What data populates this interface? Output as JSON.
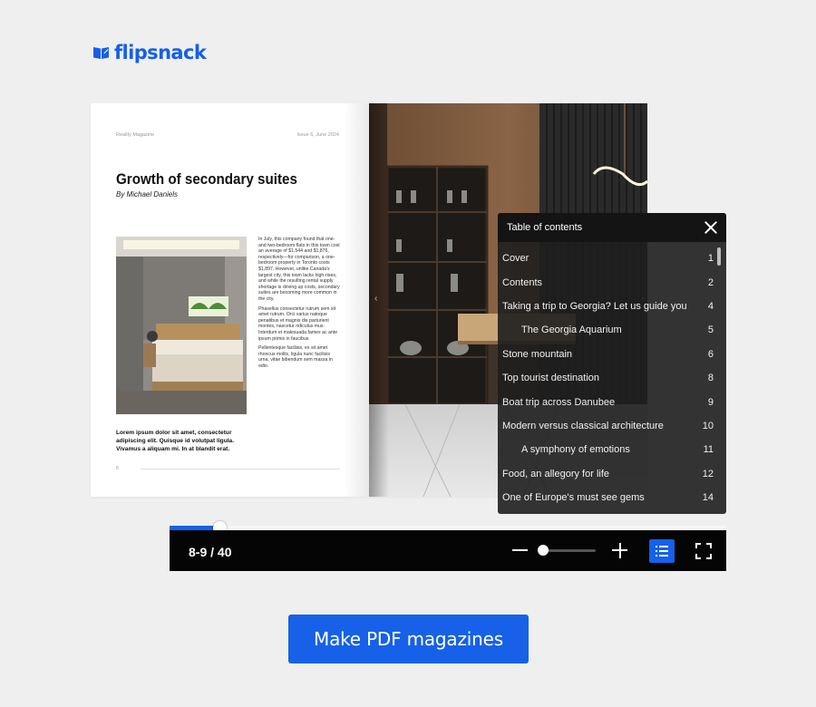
{
  "brand": {
    "name": "flipsnack",
    "color": "#1560e6"
  },
  "magazine": {
    "header_left": "Reality Magazine",
    "header_right": "Issue 6, June 2024",
    "title": "Growth of secondary suites",
    "byline": "By Michael Daniels",
    "body": [
      "In July, this company found that one- and two-bedroom flats in this town cost an average of $1,544 and $1,876, respectively—for comparison, a one-bedroom property in Toronto costs $1,897. However, unlike Canada's largest city, this town lacks high-rises, and while the resulting rental supply shortage is driving up costs, secondary suites are becoming more common in the city.",
      "Phasellus consectetur rutrum sem sit amet rutrum. Orci varius natoque penatibus et magnis dis parturient montes, nascetur ridiculus mus. Interdum et malesuada fames ac ante ipsum primis in faucibus.",
      "Pellentesque facilisis, ex sit amet rhoncus mollis, ligula nunc facilisis urna, vitae bibendum sem massa in odio."
    ],
    "lede": "Lorem ipsum dolor sit amet, consectetur adipiscing elit. Quisque id volutpat ligula. Vivamus a aliquam mi. In at blandit erat.",
    "folio": "8"
  },
  "toc": {
    "title": "Table of contents",
    "items": [
      {
        "label": "Cover",
        "page": "1",
        "indent": false
      },
      {
        "label": "Contents",
        "page": "2",
        "indent": false
      },
      {
        "label": "Taking a trip to Georgia? Let us guide you",
        "page": "4",
        "indent": false
      },
      {
        "label": "The Georgia Aquarium",
        "page": "5",
        "indent": true
      },
      {
        "label": "Stone mountain",
        "page": "6",
        "indent": false
      },
      {
        "label": "Top tourist destination",
        "page": "8",
        "indent": false
      },
      {
        "label": "Boat trip across Danubee",
        "page": "9",
        "indent": false
      },
      {
        "label": "Modern versus classical architecture",
        "page": "10",
        "indent": false
      },
      {
        "label": "A symphony of emotions",
        "page": "11",
        "indent": true
      },
      {
        "label": "Food, an allegory for life",
        "page": "12",
        "indent": false
      },
      {
        "label": "One of Europe's must see gems",
        "page": "14",
        "indent": false
      }
    ]
  },
  "viewer": {
    "page_indicator": "8-9 / 40",
    "progress_fraction": 0.09,
    "zoom_fraction": 0.0,
    "accent_color": "#1661e8"
  },
  "cta": {
    "label": "Make PDF magazines"
  }
}
